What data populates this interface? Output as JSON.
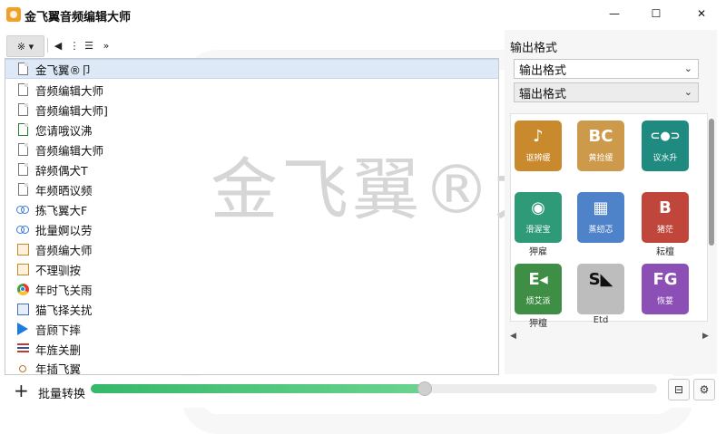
{
  "window": {
    "title": "金飞翼音频编辑大师",
    "controls": {
      "minimize": "—",
      "maximize": "☐",
      "close": "✕"
    }
  },
  "toolbar": {
    "view_label": "※ ▾",
    "buttons": [
      "◀",
      "⋮",
      "☰",
      "»"
    ]
  },
  "files": [
    {
      "icon": "document-icon",
      "name": "金飞翼®卩"
    },
    {
      "icon": "document-icon",
      "name": "音频编辑大师"
    },
    {
      "icon": "document-icon",
      "name": "音频编辑大师]"
    },
    {
      "icon": "spreadsheet-icon",
      "name": "您请哦议沸"
    },
    {
      "icon": "document-icon",
      "name": "音频编辑大师"
    },
    {
      "icon": "document-icon",
      "name": "辞频偶犬T"
    },
    {
      "icon": "document-icon",
      "name": "年频晒议频"
    },
    {
      "icon": "link-icon",
      "name": "拣飞翼大F"
    },
    {
      "icon": "link-icon",
      "name": "批量婀以劳"
    },
    {
      "icon": "calendar-icon",
      "name": "音频编大师"
    },
    {
      "icon": "calendar-icon",
      "name": "不理驯按"
    },
    {
      "icon": "chrome-icon",
      "name": "年时飞关雨"
    },
    {
      "icon": "page-icon",
      "name": "猫飞择关扰"
    },
    {
      "icon": "play-icon",
      "name": "音顾下摔"
    },
    {
      "icon": "flag-icon",
      "name": "年旌关删"
    },
    {
      "icon": "sun-icon",
      "name": "年插飞翼"
    }
  ],
  "watermark": "金飞翼®大师",
  "output": {
    "label": "输出格式",
    "select1": "输出格式",
    "select2": "辐出格式",
    "chevron": "⌄"
  },
  "formats": [
    {
      "glyph": "♪",
      "tile_label": "讴辨缓",
      "caption": "",
      "color": "#c98a2e"
    },
    {
      "glyph": "BC",
      "tile_label": "黄捡缓",
      "caption": "",
      "color": "#cc9a4a"
    },
    {
      "glyph": "⊂●⊃",
      "tile_label": "议水升",
      "caption": "",
      "color": "#1f8a80"
    },
    {
      "glyph": "◉",
      "tile_label": "滑渥宝",
      "caption": "狎雇",
      "color": "#2f9a78"
    },
    {
      "glyph": "▦",
      "tile_label": "蒸纫忑",
      "caption": "",
      "color": "#4f83c9"
    },
    {
      "glyph": "B",
      "tile_label": "猪茫",
      "caption": "耘檀",
      "color": "#c0453a"
    },
    {
      "glyph": "E◂",
      "tile_label": "烦艾派",
      "caption": "狎檀",
      "color": "#3e8f45"
    },
    {
      "glyph": "S◣",
      "tile_label": "",
      "caption": "Etd",
      "color": "#bdbdbd"
    },
    {
      "glyph": "FG",
      "tile_label": "恢荽",
      "caption": "",
      "color": "#8b4fb6"
    }
  ],
  "bottom": {
    "plus": "+",
    "batch_label": "批量转换",
    "progress": 0.59,
    "icon_list": "⊟",
    "icon_gear": "⚙"
  }
}
